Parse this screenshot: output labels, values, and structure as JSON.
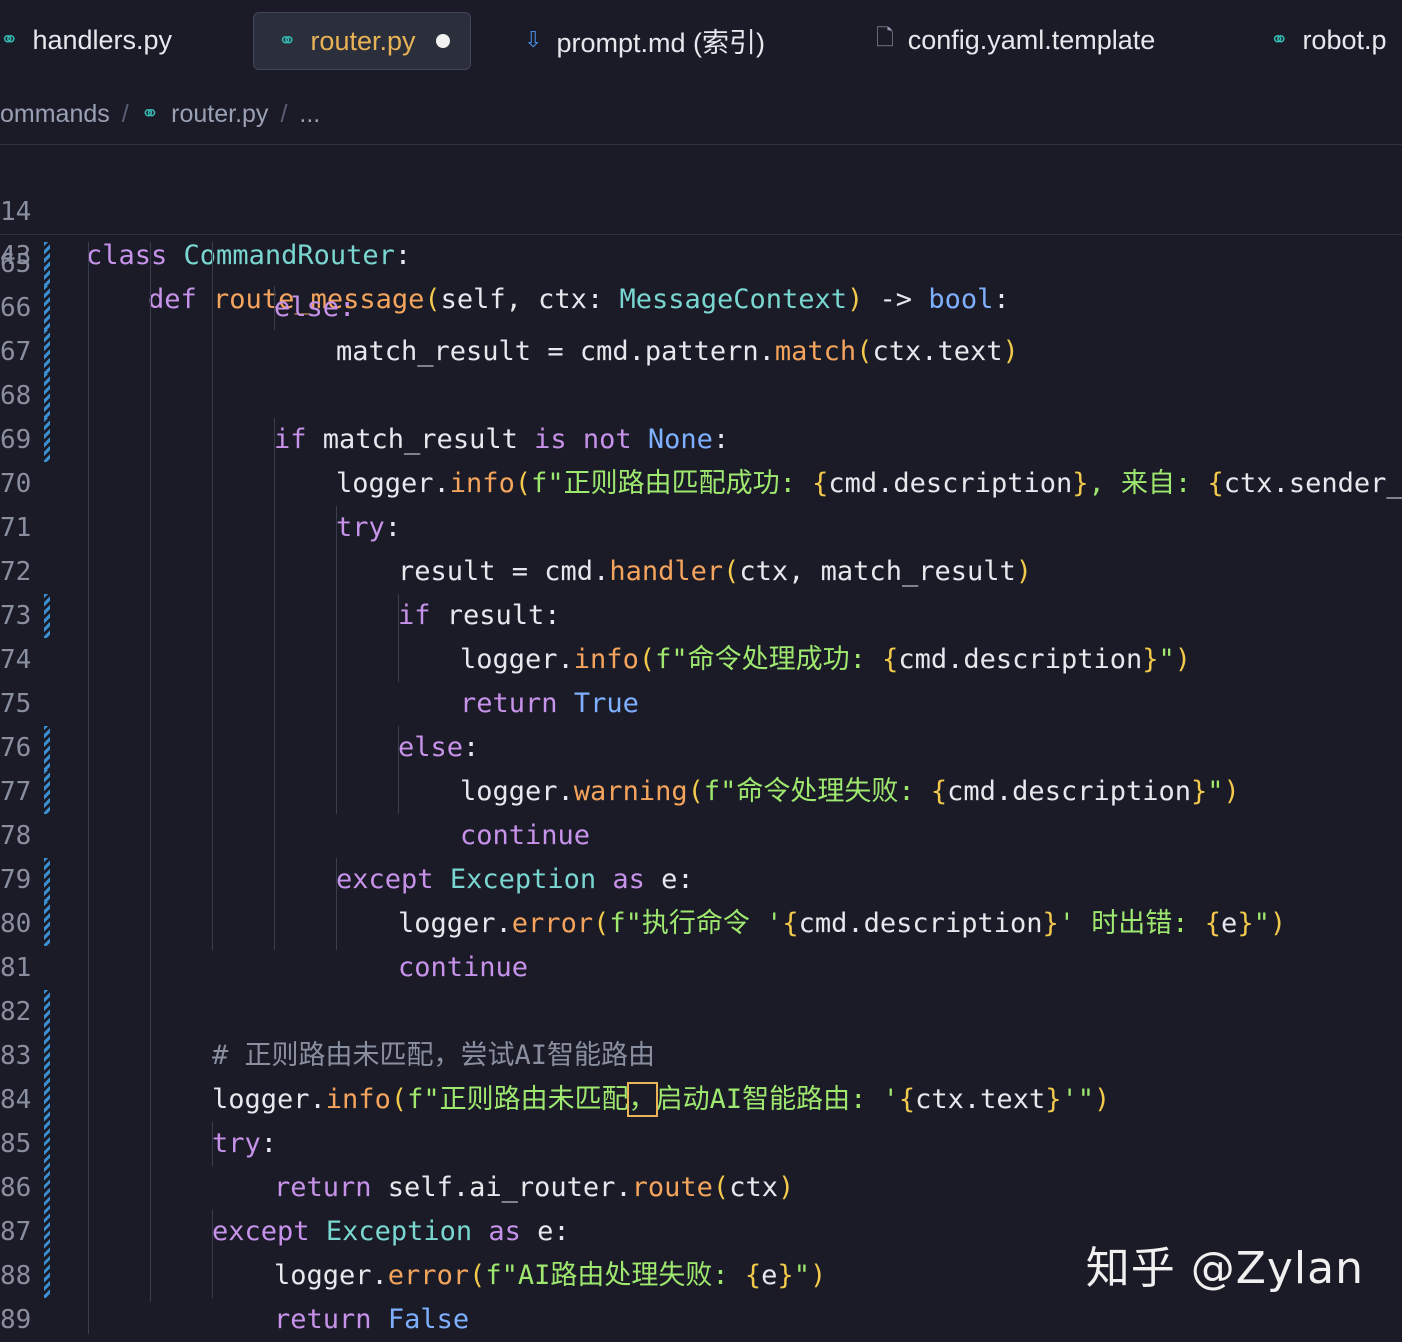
{
  "tabs": [
    {
      "label": "handlers.py",
      "icon": "python-icon"
    },
    {
      "label": "router.py",
      "icon": "python-icon",
      "active": true,
      "modified": true
    },
    {
      "label": "prompt.md (索引)",
      "icon": "download-arrow-icon"
    },
    {
      "label": "config.yaml.template",
      "icon": "file-icon"
    },
    {
      "label": "robot.p",
      "icon": "python-icon"
    }
  ],
  "breadcrumb": {
    "parent": "ommands",
    "file": "router.py",
    "more": "..."
  },
  "sticky": [
    {
      "num": "14",
      "code": "class CommandRouter:"
    },
    {
      "num": "43",
      "code": "def route_message(self, ctx: MessageContext) -> bool:"
    }
  ],
  "lines": [
    {
      "num": "65"
    },
    {
      "num": "66"
    },
    {
      "num": "67"
    },
    {
      "num": "68"
    },
    {
      "num": "69"
    },
    {
      "num": "70"
    },
    {
      "num": "71"
    },
    {
      "num": "72"
    },
    {
      "num": "73"
    },
    {
      "num": "74"
    },
    {
      "num": "75"
    },
    {
      "num": "76"
    },
    {
      "num": "77"
    },
    {
      "num": "78"
    },
    {
      "num": "79"
    },
    {
      "num": "80"
    },
    {
      "num": "81"
    },
    {
      "num": "82"
    },
    {
      "num": "83"
    },
    {
      "num": "84"
    },
    {
      "num": "85"
    },
    {
      "num": "86"
    },
    {
      "num": "87"
    },
    {
      "num": "88"
    },
    {
      "num": "89"
    }
  ],
  "code": {
    "l65": "else:",
    "l66": "match_result = cmd.pattern.match(ctx.text)",
    "l68": "if match_result is not None:",
    "l69": "logger.info(f\"正则路由匹配成功: {cmd.description}, 来自: {ctx.sender_nam",
    "l70": "try:",
    "l71": "result = cmd.handler(ctx, match_result)",
    "l72": "if result:",
    "l73": "logger.info(f\"命令处理成功: {cmd.description}\")",
    "l74": "return True",
    "l75": "else:",
    "l76": "logger.warning(f\"命令处理失败: {cmd.description}\")",
    "l77": "continue",
    "l78": "except Exception as e:",
    "l79": "logger.error(f\"执行命令 '{cmd.description}' 时出错: {e}\")",
    "l80": "continue",
    "l82": "# 正则路由未匹配，尝试AI智能路由",
    "l83": "logger.info(f\"正则路由未匹配，启动AI智能路由: '{ctx.text}'\")",
    "l84": "try:",
    "l85": "return self.ai_router.route(ctx)",
    "l86": "except Exception as e:",
    "l87": "logger.error(f\"AI路由处理失败: {e}\")",
    "l88": "return False"
  },
  "watermark": "知乎 @Zylan",
  "colors": {
    "background": "#1a1b26",
    "keyword": "#c792ea",
    "function": "#f4a45c",
    "class": "#7ad6d0",
    "string": "#9fe870",
    "paren": "#f2c94c",
    "accent": "#e8b356"
  }
}
